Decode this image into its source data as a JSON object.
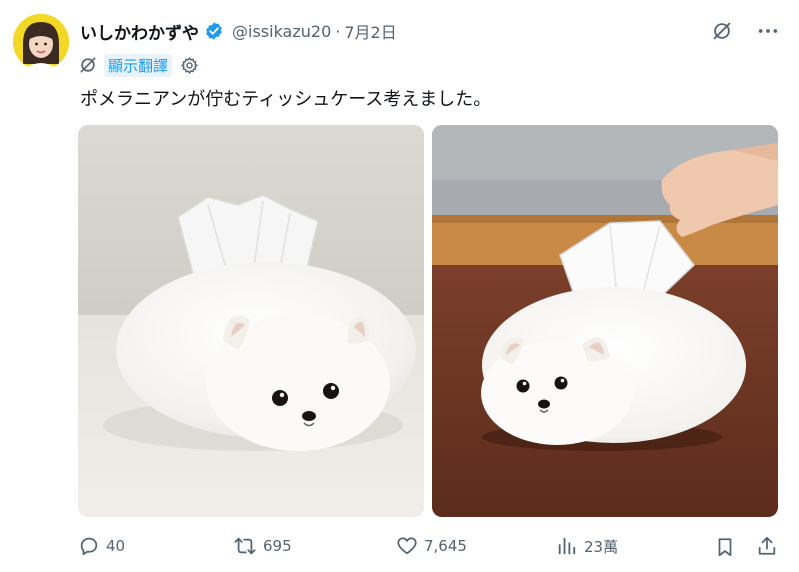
{
  "user": {
    "display_name": "いしかわかずや",
    "handle": "@issikazu20",
    "separator": "·",
    "date": "7月2日",
    "avatar_icon": "user-avatar"
  },
  "translate": {
    "label": "顯示翻譯",
    "icons": [
      "globe-slash-icon",
      "gear-icon"
    ]
  },
  "post": {
    "text": "ポメラニアンが佇むティッシュケース考えました。",
    "images": [
      {
        "icon": "pomeranian-tissue-box-photo"
      },
      {
        "icon": "pomeranian-tissue-box-on-table-photo"
      }
    ]
  },
  "actions": {
    "replies": "40",
    "reposts": "695",
    "likes": "7,645",
    "views": "23萬"
  },
  "colors": {
    "accent": "#1d9bf0",
    "text": "#0f1419",
    "muted": "#536471"
  }
}
